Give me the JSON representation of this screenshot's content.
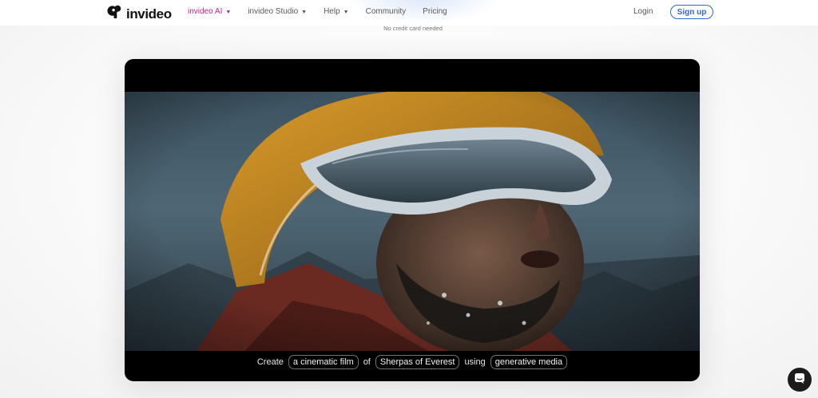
{
  "brand": {
    "name": "invideo",
    "logo_icon": "invideo-logo-icon"
  },
  "nav": {
    "items": [
      {
        "label": "invideo AI",
        "has_dropdown": true,
        "active": true
      },
      {
        "label": "invideo Studio",
        "has_dropdown": true,
        "active": false
      },
      {
        "label": "Help",
        "has_dropdown": true,
        "active": false
      },
      {
        "label": "Community",
        "has_dropdown": false,
        "active": false
      },
      {
        "label": "Pricing",
        "has_dropdown": false,
        "active": false
      }
    ],
    "login_label": "Login",
    "signup_label": "Sign up"
  },
  "hero": {
    "note": "No credit card needed"
  },
  "video": {
    "caption": {
      "word1": "Create",
      "chip1": "a cinematic film",
      "word2": "of",
      "chip2": "Sherpas of Everest",
      "word3": "using",
      "chip3": "generative media"
    }
  },
  "chat": {
    "icon": "chat-bubble-icon"
  },
  "colors": {
    "accent_pink": "#c5258a",
    "signup_blue": "#2f66e0",
    "text_dark": "#111111",
    "nav_grey": "#5a5a5a"
  }
}
